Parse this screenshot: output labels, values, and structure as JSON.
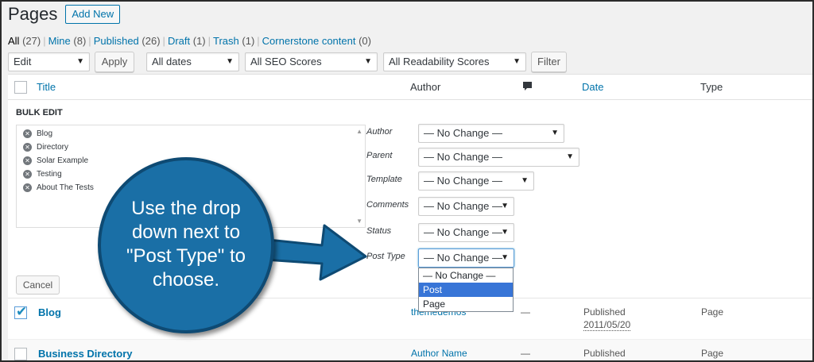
{
  "header": {
    "title": "Pages",
    "add_new": "Add New"
  },
  "filters": {
    "all": "All",
    "all_count": "(27)",
    "mine": "Mine",
    "mine_count": "(8)",
    "published": "Published",
    "published_count": "(26)",
    "draft": "Draft",
    "draft_count": "(1)",
    "trash": "Trash",
    "trash_count": "(1)",
    "cornerstone": "Cornerstone content",
    "cornerstone_count": "(0)",
    "separator": "|"
  },
  "toolbar": {
    "bulk_action": "Edit",
    "apply": "Apply",
    "dates": "All dates",
    "seo": "All SEO Scores",
    "readability": "All Readability Scores",
    "filter": "Filter",
    "dropdown_arrow": "▼"
  },
  "columns": {
    "title": "Title",
    "author": "Author",
    "date": "Date",
    "type": "Type"
  },
  "bulk_edit": {
    "heading": "BULK EDIT",
    "items": [
      {
        "label": "Blog"
      },
      {
        "label": "Directory"
      },
      {
        "label": "Solar Example"
      },
      {
        "label": "Testing"
      },
      {
        "label": "About The Tests"
      }
    ],
    "remove_glyph": "✕",
    "fields": {
      "author_label": "Author",
      "author_value": "— No Change —",
      "parent_label": "Parent",
      "parent_value": "— No Change —",
      "template_label": "Template",
      "template_value": "— No Change —",
      "comments_label": "Comments",
      "comments_value": "— No Change —",
      "status_label": "Status",
      "status_value": "— No Change —",
      "post_type_label": "Post Type",
      "post_type_value": "— No Change —"
    },
    "post_type_options": [
      "— No Change —",
      "Post",
      "Page"
    ],
    "cancel": "Cancel"
  },
  "rows": [
    {
      "title": "Blog",
      "author": "themedemos",
      "comments": "—",
      "status": "Published",
      "date": "2011/05/20",
      "type": "Page"
    },
    {
      "title": "Business Directory",
      "author": "Author Name",
      "comments": "—",
      "status": "Published",
      "type": "Page"
    }
  ],
  "callout": {
    "text": "Use the drop down next to \"Post Type\" to choose."
  },
  "colors": {
    "link": "#0073aa",
    "callout_fill": "#1a6fa6",
    "callout_border": "#0e4a73",
    "selected_option": "#3875d7"
  }
}
